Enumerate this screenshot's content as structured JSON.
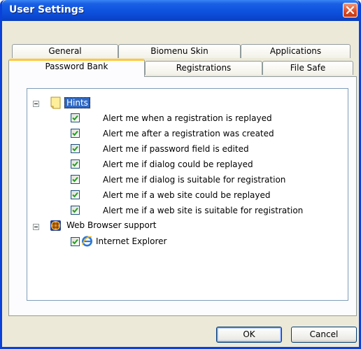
{
  "window": {
    "title": "User Settings",
    "colors": {
      "titlebar": "#0a46cf",
      "close": "#dc4a26",
      "selection": "#316ac5",
      "active_tab_accent": "#ffc83c"
    }
  },
  "tabs_back": [
    {
      "label": "General"
    },
    {
      "label": "Biomenu Skin"
    },
    {
      "label": "Applications"
    }
  ],
  "tabs_front": [
    {
      "label": "Password Bank",
      "active": true
    },
    {
      "label": "Registrations"
    },
    {
      "label": "File Safe"
    }
  ],
  "tree": {
    "hints": {
      "label": "Hints",
      "icon": "note-icon",
      "expanded": true,
      "selected": true,
      "items": [
        {
          "label": "Alert me when a registration is replayed",
          "checked": true
        },
        {
          "label": "Alert me after a registration was created",
          "checked": true
        },
        {
          "label": "Alert me if password field is edited",
          "checked": true
        },
        {
          "label": "Alert me if dialog could be replayed",
          "checked": true
        },
        {
          "label": "Alert me if dialog is suitable for registration",
          "checked": true
        },
        {
          "label": "Alert me if a web site could be replayed",
          "checked": true
        },
        {
          "label": "Alert me if a web site is suitable for registration",
          "checked": true
        }
      ]
    },
    "browser": {
      "label": "Web Browser support",
      "icon": "globe-grid-icon",
      "expanded": true,
      "items": [
        {
          "label": "Internet Explorer",
          "checked": true,
          "icon": "internet-explorer-icon"
        }
      ]
    }
  },
  "buttons": {
    "ok": "OK",
    "cancel": "Cancel"
  }
}
